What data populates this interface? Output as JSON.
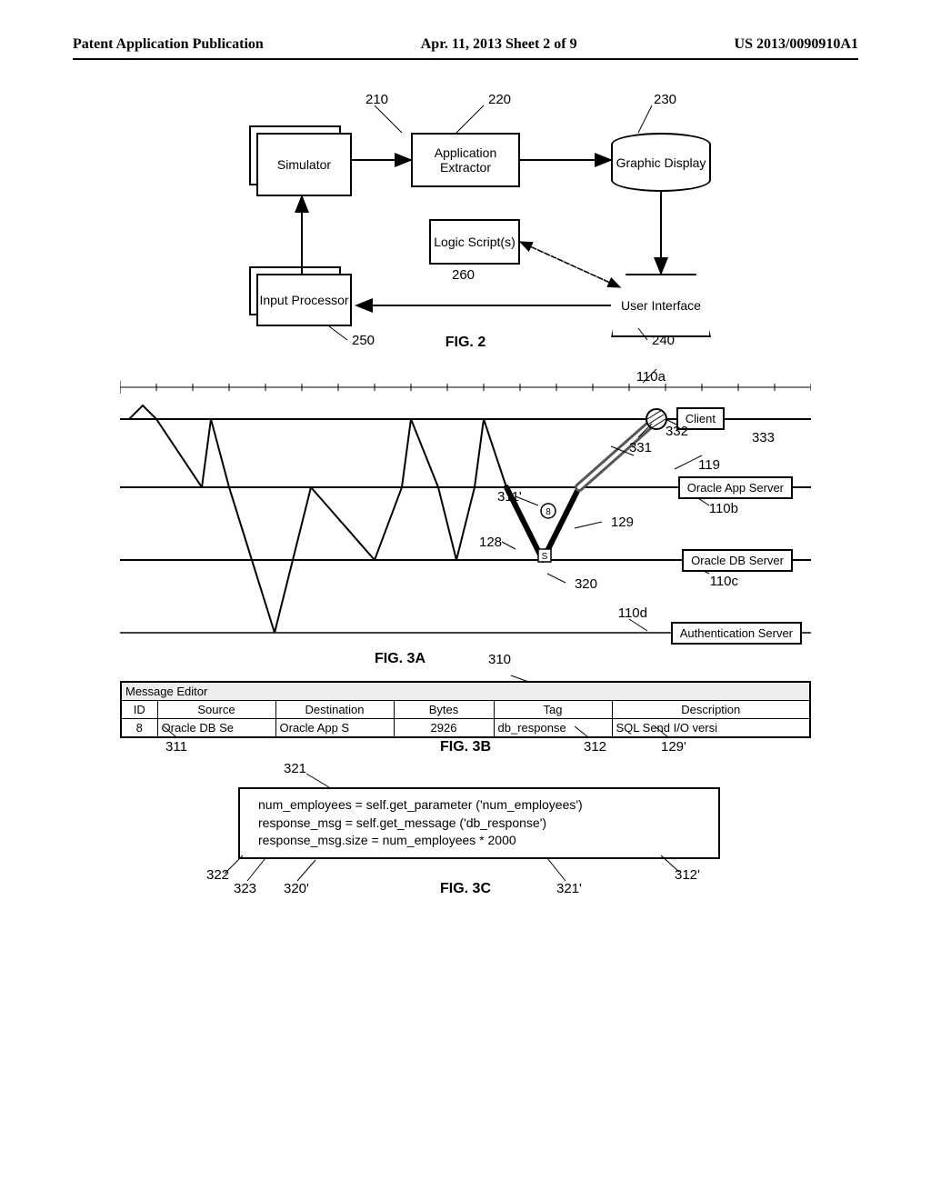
{
  "header": {
    "left": "Patent Application Publication",
    "mid": "Apr. 11, 2013  Sheet 2 of 9",
    "right": "US 2013/0090910A1"
  },
  "fig2": {
    "caption": "FIG. 2",
    "simulator": "Simulator",
    "appExtractor": "Application Extractor",
    "graphic": "Graphic Display",
    "logic": "Logic Script(s)",
    "input": "Input Processor",
    "ui": "User Interface",
    "n210": "210",
    "n220": "220",
    "n230": "230",
    "n240": "240",
    "n250": "250",
    "n260": "260"
  },
  "fig3a": {
    "caption": "FIG. 3A",
    "client": "Client",
    "appServer": "Oracle App Server",
    "dbServer": "Oracle DB Server",
    "authServer": "Authentication Server",
    "n110a": "110a",
    "n110b": "110b",
    "n110c": "110c",
    "n110d": "110d",
    "n119": "119",
    "n128": "128",
    "n129": "129",
    "n311p": "311'",
    "n320": "320",
    "n331": "331",
    "n332": "332",
    "n333": "333",
    "n310": "310",
    "badgeS": "S",
    "badge8": "8"
  },
  "fig3b": {
    "caption": "FIG. 3B",
    "title": "Message Editor",
    "cols": [
      "ID",
      "Source",
      "Destination",
      "Bytes",
      "Tag",
      "Description"
    ],
    "row": [
      "8",
      "Oracle DB Se",
      "Oracle App S",
      "2926",
      "db_response",
      "SQL Send I/O versi"
    ],
    "n311": "311",
    "n312": "312",
    "n129p": "129'"
  },
  "fig3c": {
    "caption": "FIG. 3C",
    "line1": "num_employees = self.get_parameter ('num_employees')",
    "line2": "response_msg = self.get_message ('db_response')",
    "line3": "response_msg.size = num_employees * 2000",
    "n321": "321",
    "n322": "322",
    "n323": "323",
    "n320p": "320'",
    "n321p": "321'",
    "n312p": "312'"
  }
}
